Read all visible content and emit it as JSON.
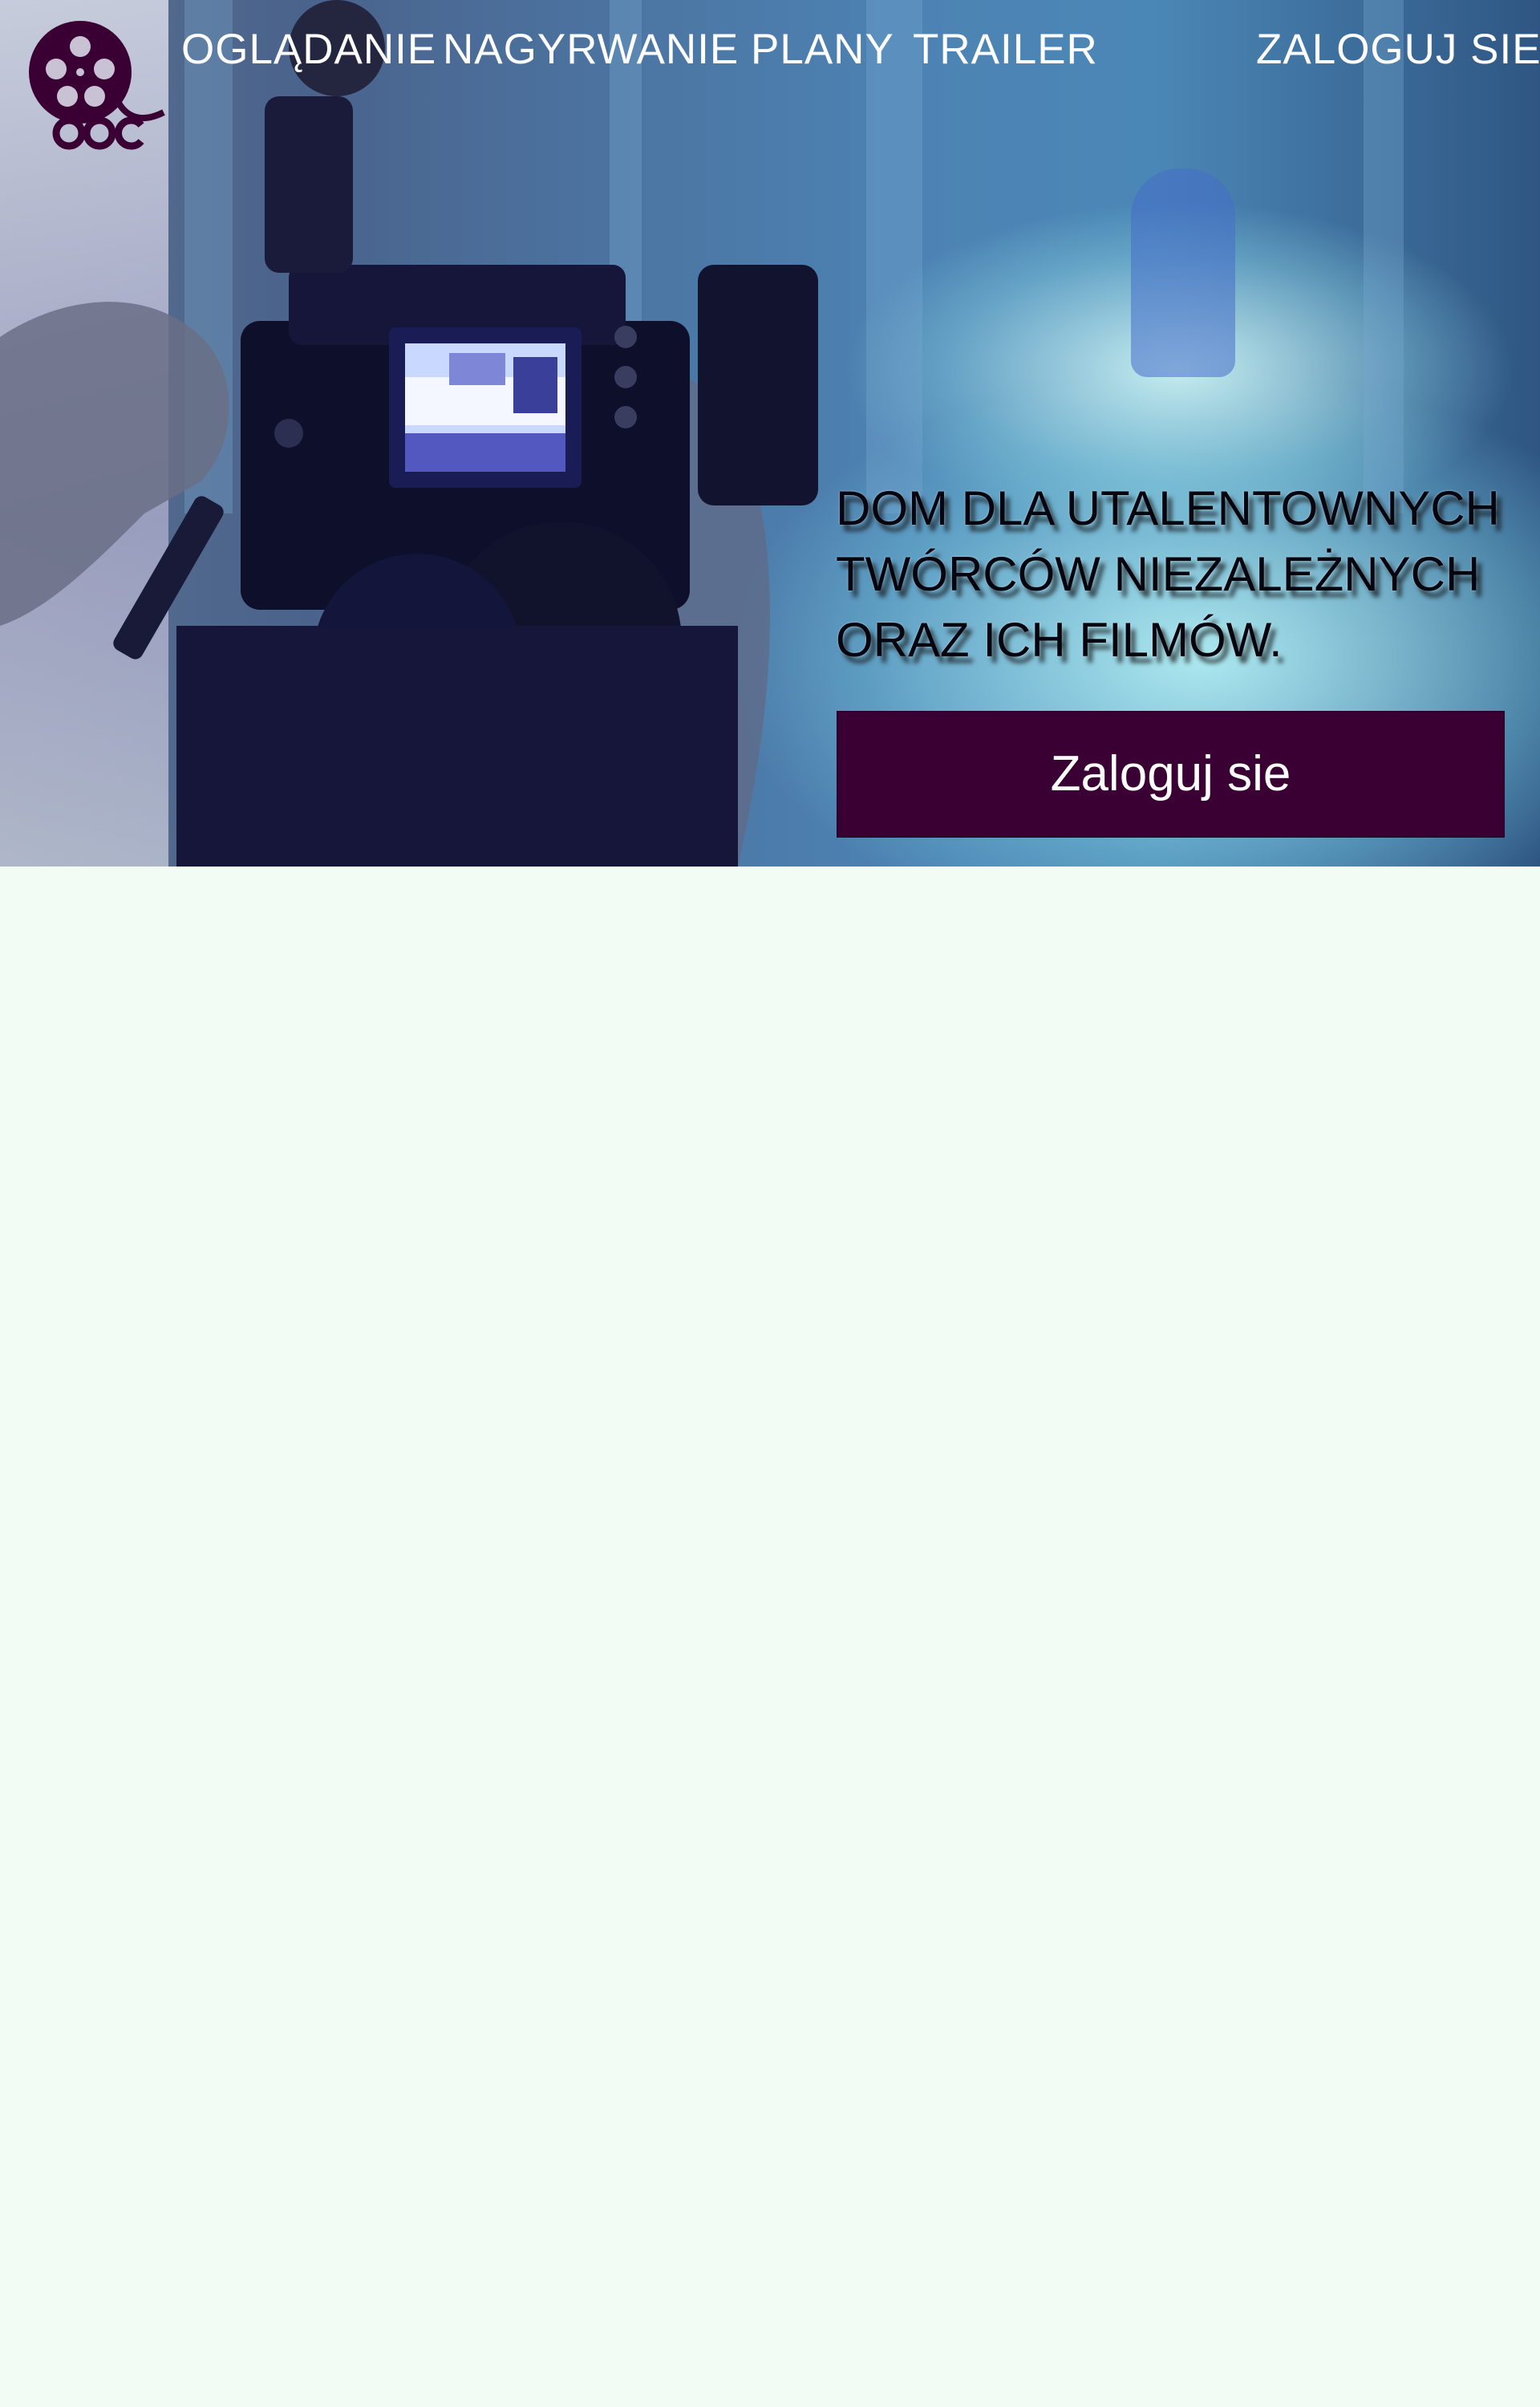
{
  "logo": {
    "text": "ODC"
  },
  "nav": {
    "items": [
      {
        "label": "OGLĄDANIE"
      },
      {
        "label": "NAGYRWANIE"
      },
      {
        "label": "PLANY"
      },
      {
        "label": "TRAILER"
      }
    ],
    "login_label": "ZALOGUJ SIE"
  },
  "hero": {
    "headline_lines": [
      "DOM DLA UTALENTOWNYCH",
      "TWÓRCÓW NIEZALEŻNYCH",
      "ORAZ ICH FILMÓW."
    ],
    "cta_label": "Zaloguj sie"
  },
  "colors": {
    "brand": "#3a0033",
    "page_background": "#f2fcf4",
    "nav_text": "#ffffff"
  },
  "icons": {
    "logo": "film-reel-icon"
  }
}
